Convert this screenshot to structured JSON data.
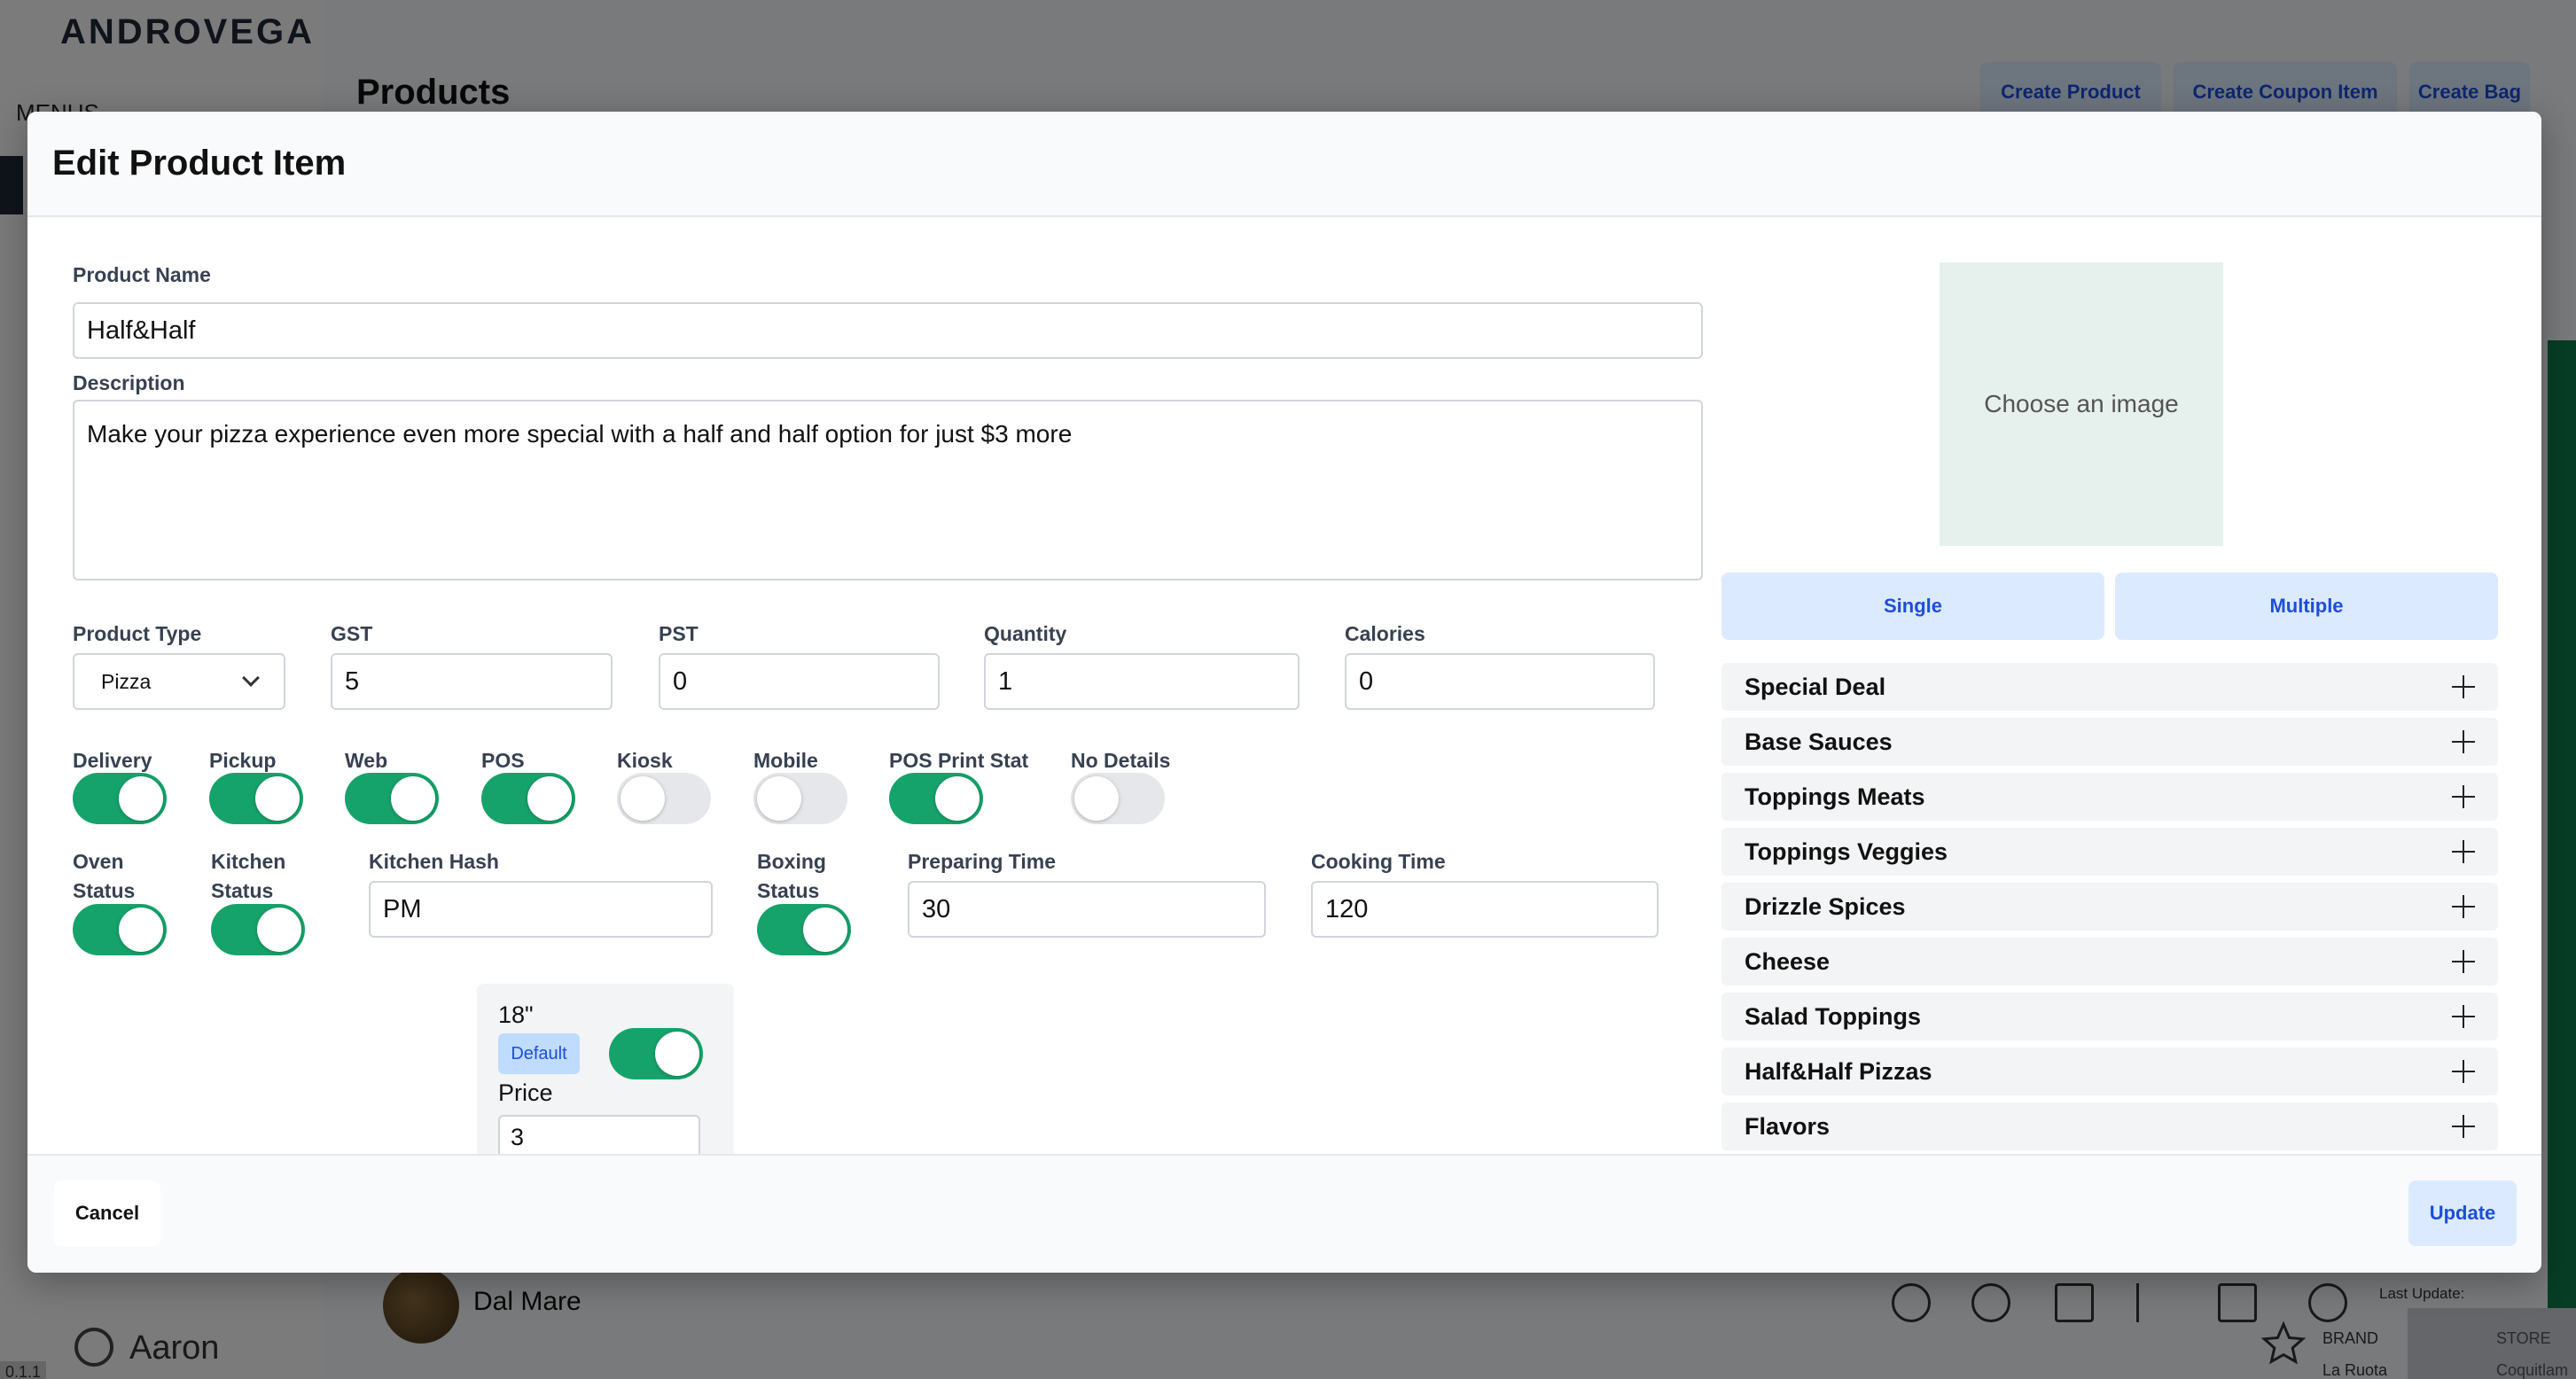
{
  "app": {
    "logo": "ANDROVEGA",
    "sidebar_items": [
      "MENUS"
    ],
    "page_title": "Products",
    "header_buttons": [
      "Create Product",
      "Create Coupon Item",
      "Create Bag"
    ],
    "user_name": "Aaron",
    "version": "0.1.1",
    "background_row": {
      "name": "Dal Mare",
      "last_update_label": "Last Update:"
    },
    "footer": {
      "brand_label": "BRAND",
      "brand_value": "La Ruota",
      "store_label": "STORE",
      "store_value": "Coquitlam"
    }
  },
  "modal": {
    "title": "Edit Product Item",
    "product_name_label": "Product Name",
    "product_name": "Half&Half",
    "description_label": "Description",
    "description": "Make your pizza experience even more special with a half and half option for just $3 more",
    "product_type_label": "Product Type",
    "product_type": "Pizza",
    "gst_label": "GST",
    "gst": "5",
    "pst_label": "PST",
    "pst": "0",
    "quantity_label": "Quantity",
    "quantity": "1",
    "calories_label": "Calories",
    "calories": "0",
    "toggles_row1": [
      {
        "label": "Delivery",
        "on": true
      },
      {
        "label": "Pickup",
        "on": true
      },
      {
        "label": "Web",
        "on": true
      },
      {
        "label": "POS",
        "on": true
      },
      {
        "label": "Kiosk",
        "on": false
      },
      {
        "label": "Mobile",
        "on": false
      },
      {
        "label": "POS Print Stat",
        "on": true
      },
      {
        "label": "No Details",
        "on": false
      }
    ],
    "oven_status_label": "Oven Status",
    "oven_status": true,
    "kitchen_status_label": "Kitchen Status",
    "kitchen_status": true,
    "kitchen_hash_label": "Kitchen Hash",
    "kitchen_hash": "PM",
    "boxing_status_label": "Boxing Status",
    "boxing_status": true,
    "preparing_time_label": "Preparing Time",
    "preparing_time": "30",
    "cooking_time_label": "Cooking Time",
    "cooking_time": "120",
    "variant": {
      "size": "18\"",
      "badge": "Default",
      "enabled": true,
      "price_label": "Price",
      "price": "3"
    },
    "image_placeholder": "Choose an image",
    "image_modes": [
      "Single",
      "Multiple"
    ],
    "modifier_groups": [
      "Special Deal",
      "Base Sauces",
      "Toppings Meats",
      "Toppings Veggies",
      "Drizzle Spices",
      "Cheese",
      "Salad Toppings",
      "Half&Half Pizzas",
      "Flavors"
    ],
    "cancel_label": "Cancel",
    "update_label": "Update"
  },
  "colors": {
    "accent": "#1d4ed8",
    "toggle_on": "#16a36b",
    "button_bg": "#dbeafe"
  }
}
